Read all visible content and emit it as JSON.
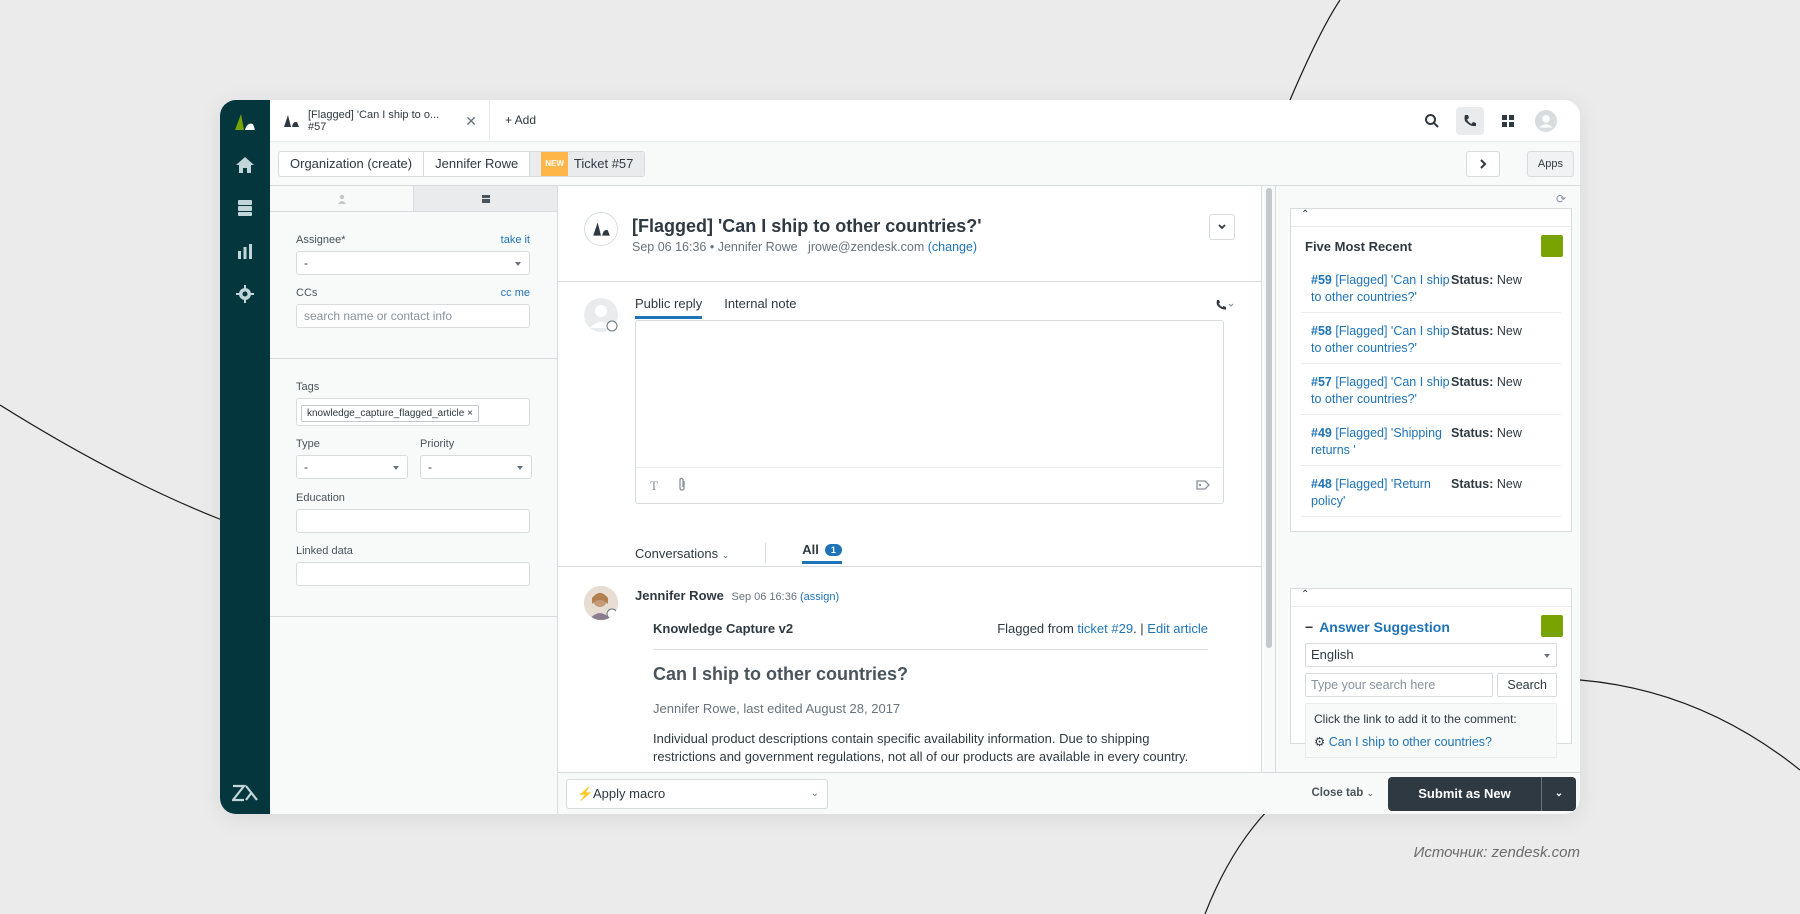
{
  "caption": "Источник: zendesk.com",
  "topbar": {
    "tab_title_line1": "[Flagged] 'Can I ship to o...",
    "tab_title_line2": "#57",
    "add_label": "+ Add"
  },
  "breadcrumbs": {
    "organization": "Organization (create)",
    "requester": "Jennifer Rowe",
    "new_badge": "NEW",
    "ticket": "Ticket #57",
    "apps_label": "Apps"
  },
  "props": {
    "assignee_label": "Assignee*",
    "take_it": "take it",
    "assignee_value": "-",
    "ccs_label": "CCs",
    "cc_me": "cc me",
    "ccs_placeholder": "search name or contact info",
    "tags_label": "Tags",
    "tag_value": "knowledge_capture_flagged_article ×",
    "type_label": "Type",
    "type_value": "-",
    "priority_label": "Priority",
    "priority_value": "-",
    "education_label": "Education",
    "linked_label": "Linked data"
  },
  "ticket": {
    "title": "[Flagged] 'Can I ship to other countries?'",
    "date": "Sep 06 16:36",
    "requester": "Jennifer Rowe",
    "email": "jrowe@zendesk.com",
    "change": "(change)"
  },
  "composer": {
    "public_reply": "Public reply",
    "internal_note": "Internal note"
  },
  "conversations": {
    "label": "Conversations",
    "all_label": "All",
    "all_count": "1"
  },
  "message": {
    "author": "Jennifer Rowe",
    "time": "Sep 06 16:36",
    "assign": "(assign)",
    "kc_title": "Knowledge Capture v2",
    "flagged_from": "Flagged from",
    "ticket_link": "ticket #29",
    "sep": ". |",
    "edit_article": "Edit article",
    "article_title": "Can I ship to other countries?",
    "article_meta": "Jennifer Rowe, last edited August 28, 2017",
    "article_body": "Individual product descriptions contain specific availability information. Due to shipping restrictions and government regulations, not all of our products are available in every country."
  },
  "bottombar": {
    "apply_macro": "Apply macro",
    "close_tab": "Close tab",
    "submit": "Submit as New"
  },
  "apps_panel": {
    "five_recent_title": "Five Most Recent",
    "recent": [
      {
        "num": "#59",
        "text": "[Flagged] 'Can I ship to other countries?'",
        "status_label": "Status:",
        "status": "New"
      },
      {
        "num": "#58",
        "text": "[Flagged] 'Can I ship to other countries?'",
        "status_label": "Status:",
        "status": "New"
      },
      {
        "num": "#57",
        "text": "[Flagged] 'Can I ship to other countries?'",
        "status_label": "Status:",
        "status": "New"
      },
      {
        "num": "#49",
        "text": "[Flagged] 'Shipping returns '",
        "status_label": "Status:",
        "status": "New"
      },
      {
        "num": "#48",
        "text": "[Flagged] 'Return policy'",
        "status_label": "Status:",
        "status": "New"
      }
    ],
    "answer_title": "Answer Suggestion",
    "language": "English",
    "search_placeholder": "Type your search here",
    "search_button": "Search",
    "hint": "Click the link to add it to the comment:",
    "suggestion": "Can I ship to other countries?"
  },
  "colors": {
    "nav_bg": "#03363d",
    "link": "#1f73b7",
    "submit_bg": "#2f3941",
    "app_badge": "#78a300",
    "new_badge": "#ffb648"
  }
}
